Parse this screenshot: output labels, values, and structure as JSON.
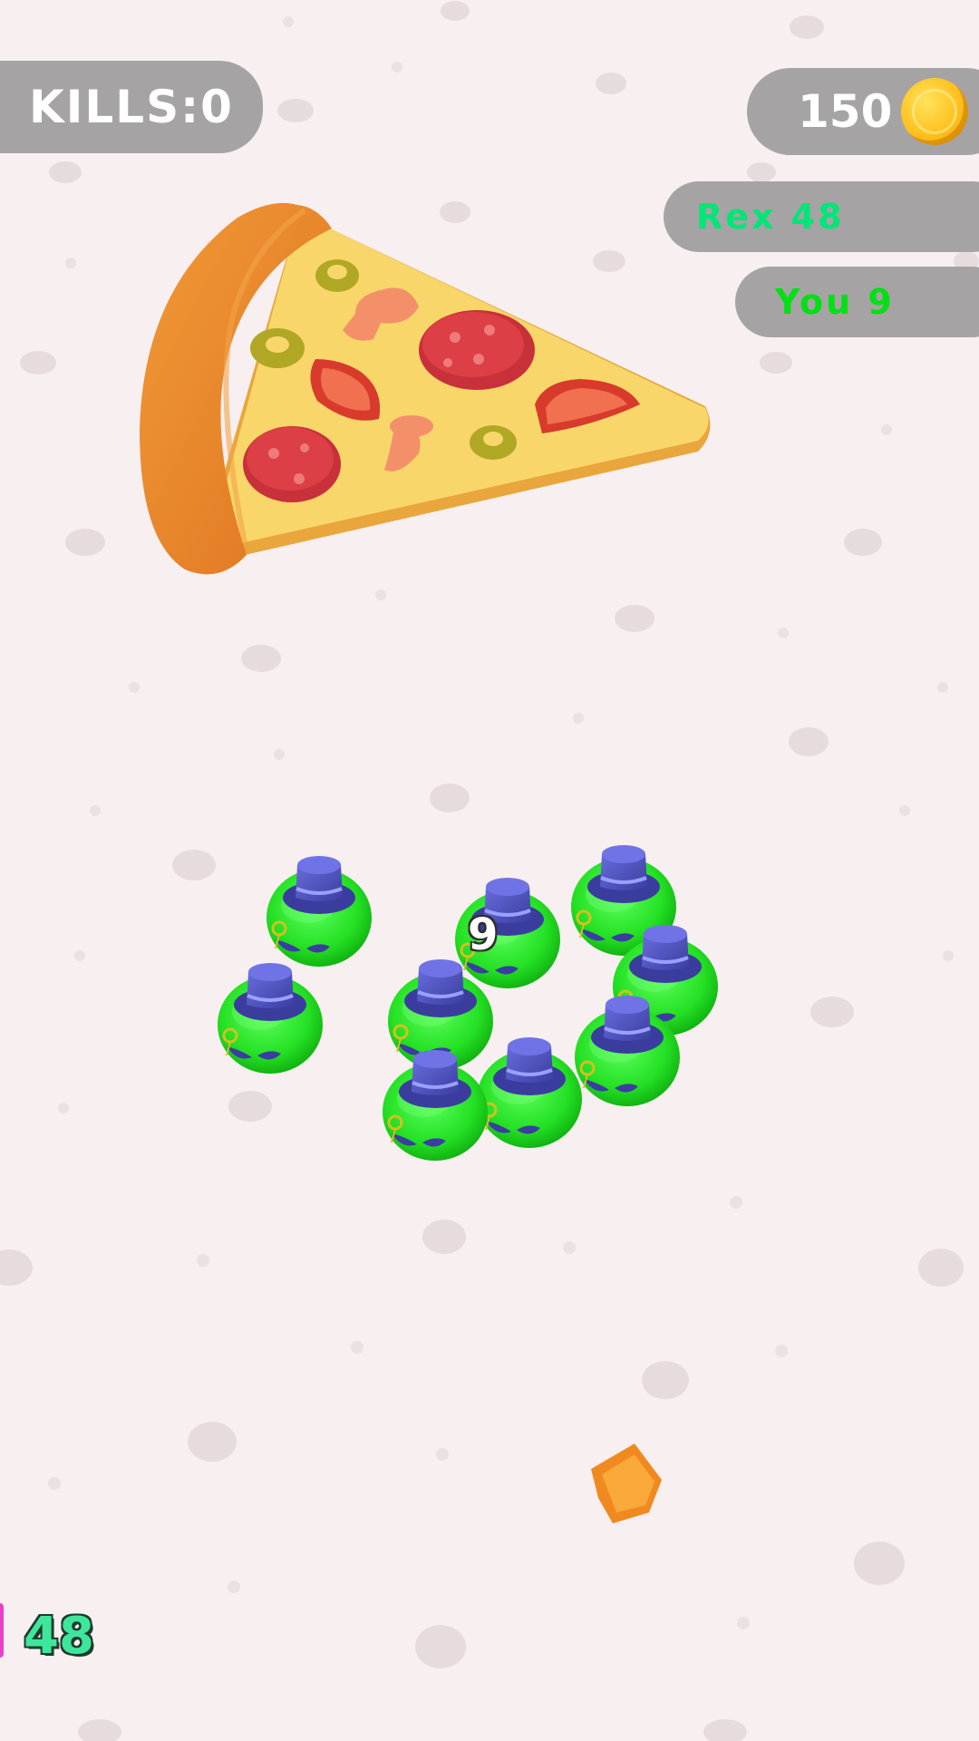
{
  "hud": {
    "kills_label": "KILLS:0",
    "coins": "150",
    "coin_icon": "gold-coin-icon"
  },
  "leaderboard": [
    {
      "label": "Rex 48",
      "color": "#00e676"
    },
    {
      "label": "You 9",
      "color": "#00e013"
    }
  ],
  "crowd": {
    "count": "9",
    "color": "#2ee63a",
    "hat_color": "#4c4fb8"
  },
  "rival": {
    "count": "48",
    "color": "#3ee69b"
  },
  "world": {
    "background": "#f7eff0",
    "items": [
      "pizza-slice",
      "cheese-cube"
    ]
  }
}
